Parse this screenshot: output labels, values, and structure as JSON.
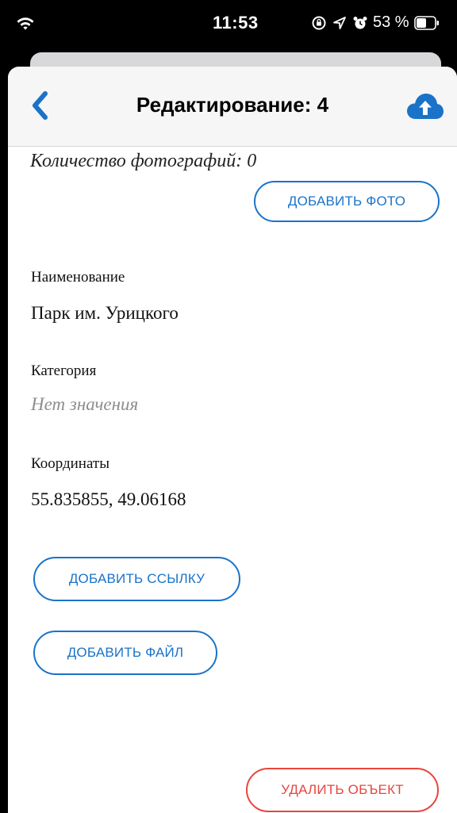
{
  "status_bar": {
    "time": "11:53",
    "battery_percent": "53 %"
  },
  "nav": {
    "title": "Редактирование: 4",
    "back_icon": "chevron-left-icon",
    "upload_icon": "cloud-upload-icon",
    "accent_color": "#1a73c8"
  },
  "photos": {
    "count_text": "Количество фотографий: 0",
    "add_button": "ДОБАВИТЬ ФОТО"
  },
  "fields": {
    "name": {
      "label": "Наименование",
      "value": "Парк им. Урицкого"
    },
    "category": {
      "label": "Категория",
      "placeholder": "Нет значения"
    },
    "coordinates": {
      "label": "Координаты",
      "value": "55.835855, 49.06168"
    }
  },
  "actions": {
    "add_link": "ДОБАВИТЬ ССЫЛКУ",
    "add_file": "ДОБАВИТЬ ФАЙЛ",
    "delete": "УДАЛИТЬ ОБЪЕКТ",
    "delete_color": "#e8453c"
  }
}
